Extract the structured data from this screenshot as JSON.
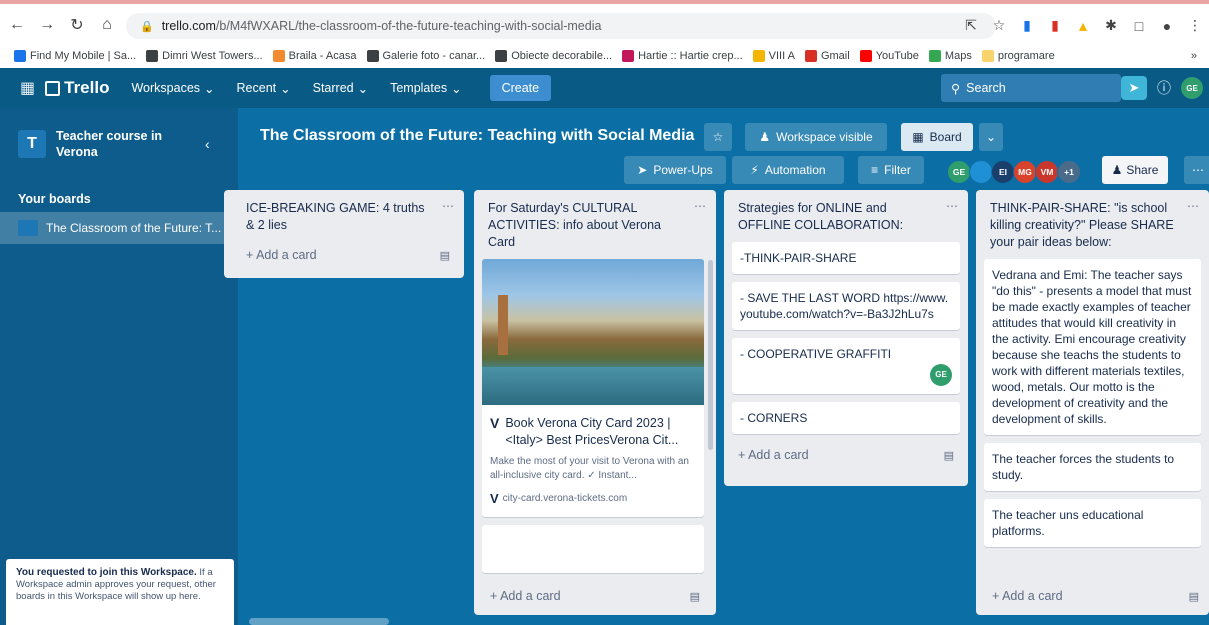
{
  "browser": {
    "url_domain": "trello.com",
    "url_path": "/b/M4fWXARL/the-classroom-of-the-future-teaching-with-social-media",
    "bookmarks": [
      {
        "label": "Find My Mobile | Sa...",
        "color": "#1a73e8"
      },
      {
        "label": "Dimri West Towers...",
        "color": "#3c4043"
      },
      {
        "label": "Braila - Acasa",
        "color": "#f28b30"
      },
      {
        "label": "Galerie foto - canar...",
        "color": "#3c4043"
      },
      {
        "label": "Obiecte decorabile...",
        "color": "#3c4043"
      },
      {
        "label": "Hartie :: Hartie crep...",
        "color": "#c2185b"
      },
      {
        "label": "VIII A",
        "color": "#f4b400"
      },
      {
        "label": "Gmail",
        "color": "#d93025"
      },
      {
        "label": "YouTube",
        "color": "#ff0000"
      },
      {
        "label": "Maps",
        "color": "#34a853"
      },
      {
        "label": "programare",
        "color": "#f9d36b"
      }
    ]
  },
  "header": {
    "logo": "Trello",
    "menus": [
      "Workspaces",
      "Recent",
      "Starred",
      "Templates"
    ],
    "create": "Create",
    "search_placeholder": "Search",
    "user_initials": "GE"
  },
  "sidebar": {
    "workspace_initial": "T",
    "workspace_name": "Teacher course in Verona",
    "your_boards": "Your boards",
    "board_item": "The Classroom of the Future: T...",
    "notice_bold": "You requested to join this Workspace.",
    "notice_text": " If a Workspace admin approves your request, other boards in this Workspace will show up here."
  },
  "board": {
    "title": "The Classroom of the Future: Teaching with Social Media",
    "visibility": "Workspace visible",
    "view": "Board",
    "power_ups": "Power-Ups",
    "automation": "Automation",
    "filter": "Filter",
    "members": [
      {
        "initials": "GE",
        "color": "#2f9e6c"
      },
      {
        "initials": "",
        "color": "#1f8fd6"
      },
      {
        "initials": "EI",
        "color": "#1b3f6b"
      },
      {
        "initials": "MG",
        "color": "#d9432c"
      },
      {
        "initials": "VM",
        "color": "#c9372c"
      },
      {
        "initials": "+1",
        "color": "#4a6a8a"
      }
    ],
    "share": "Share"
  },
  "lists": [
    {
      "title": "ICE-BREAKING GAME: 4 truths & 2 lies",
      "cards": [],
      "add": "+ Add a card"
    },
    {
      "title": "For Saturday's CULTURAL ACTIVITIES: info about Verona Card",
      "link_card": {
        "title": "Book Verona City Card 2023 | <Italy> Best PricesVerona Cit...",
        "desc": "Make the most of your visit to Verona with an all-inclusive city card. ✓ Instant...",
        "domain": "city-card.verona-tickets.com"
      },
      "add": "+ Add a card"
    },
    {
      "title": "Strategies for ONLINE and OFFLINE COLLABORATION:",
      "cards": [
        "-THINK-PAIR-SHARE",
        "- SAVE THE LAST WORD https://www.youtube.com/watch?v=-Ba3J2hLu7s",
        "- COOPERATIVE GRAFFITI",
        "- CORNERS"
      ],
      "badge": "GE",
      "add": "+ Add a card"
    },
    {
      "title": "THINK-PAIR-SHARE: \"is school killing creativity?\" Please SHARE your pair ideas below:",
      "cards": [
        "Vedrana and Emi: The teacher says \"do this\" - presents a model that must be made exactly examples of teacher attitudes that would kill creativity in the activity. Emi encourage creativity because she teachs the students to work with different materials textiles, wood, metals. Our motto is the development of creativity and the development of skills.",
        "The teacher forces the students to study.",
        "The teacher uns educational platforms."
      ],
      "add": "+ Add a card"
    }
  ]
}
